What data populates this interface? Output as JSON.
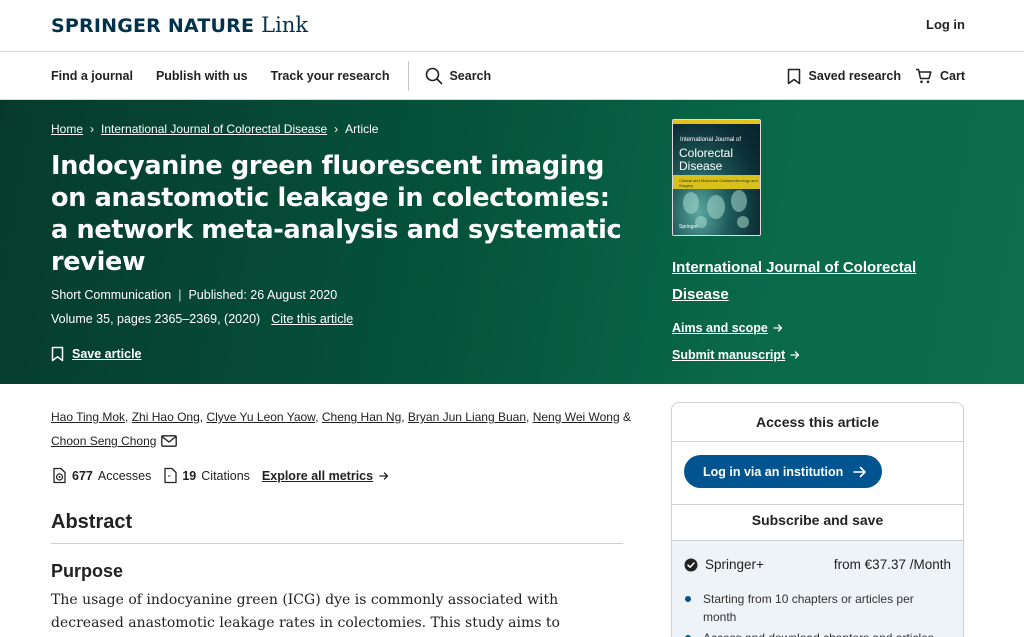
{
  "header": {
    "logo_main": "SPRINGER NATURE",
    "logo_sub": "Link",
    "login": "Log in"
  },
  "nav": {
    "find_journal": "Find a journal",
    "publish": "Publish with us",
    "track": "Track your research",
    "search": "Search",
    "saved": "Saved research",
    "cart": "Cart"
  },
  "breadcrumb": {
    "home": "Home",
    "journal": "International Journal of Colorectal Disease",
    "current": "Article"
  },
  "article": {
    "title": "Indocyanine green fluorescent imaging on anastomotic leakage in colectomies: a network meta-analysis and systematic review",
    "type": "Short Communication",
    "published": "Published: 26 August 2020",
    "volume": "Volume 35, pages 2365–2369, (2020)",
    "cite": "Cite this article",
    "save": "Save article"
  },
  "cover": {
    "small": "International Journal of",
    "big_line1": "Colorectal",
    "big_line2": "Disease",
    "band": "Clinical and Molecular Gastroenterology and Surgery",
    "publisher": "Springer"
  },
  "journal_panel": {
    "name": "International Journal of Colorectal Disease",
    "aims": "Aims and scope",
    "submit": "Submit manuscript"
  },
  "authors": {
    "a1": "Hao Ting Mok",
    "a2": "Zhi Hao Ong",
    "a3": "Clyve Yu Leon Yaow",
    "a4": "Cheng Han Ng",
    "a5": "Bryan Jun Liang Buan",
    "a6": "Neng Wei Wong",
    "amp": "&",
    "a7": "Choon Seng Chong"
  },
  "metrics": {
    "accesses_count": "677",
    "accesses_label": "Accesses",
    "citations_count": "19",
    "citations_label": "Citations",
    "explore": "Explore all metrics"
  },
  "abstract": {
    "heading": "Abstract",
    "purpose_heading": "Purpose",
    "purpose_text": "The usage of indocyanine green (ICG) dye is commonly associated with decreased anastomotic leakage rates in colectomies. This study aims to perform a network meta-"
  },
  "access": {
    "heading": "Access this article",
    "institution_button": "Log in via an institution",
    "subscribe_heading": "Subscribe and save",
    "plan_name": "Springer+",
    "plan_price": "from €37.37 /Month",
    "benefit1": "Starting from 10 chapters or articles per month",
    "benefit2": "Access and download chapters and articles"
  },
  "colors": {
    "brand_navy": "#01324b",
    "hero_green": "#05533a",
    "button_blue": "#01548f"
  }
}
